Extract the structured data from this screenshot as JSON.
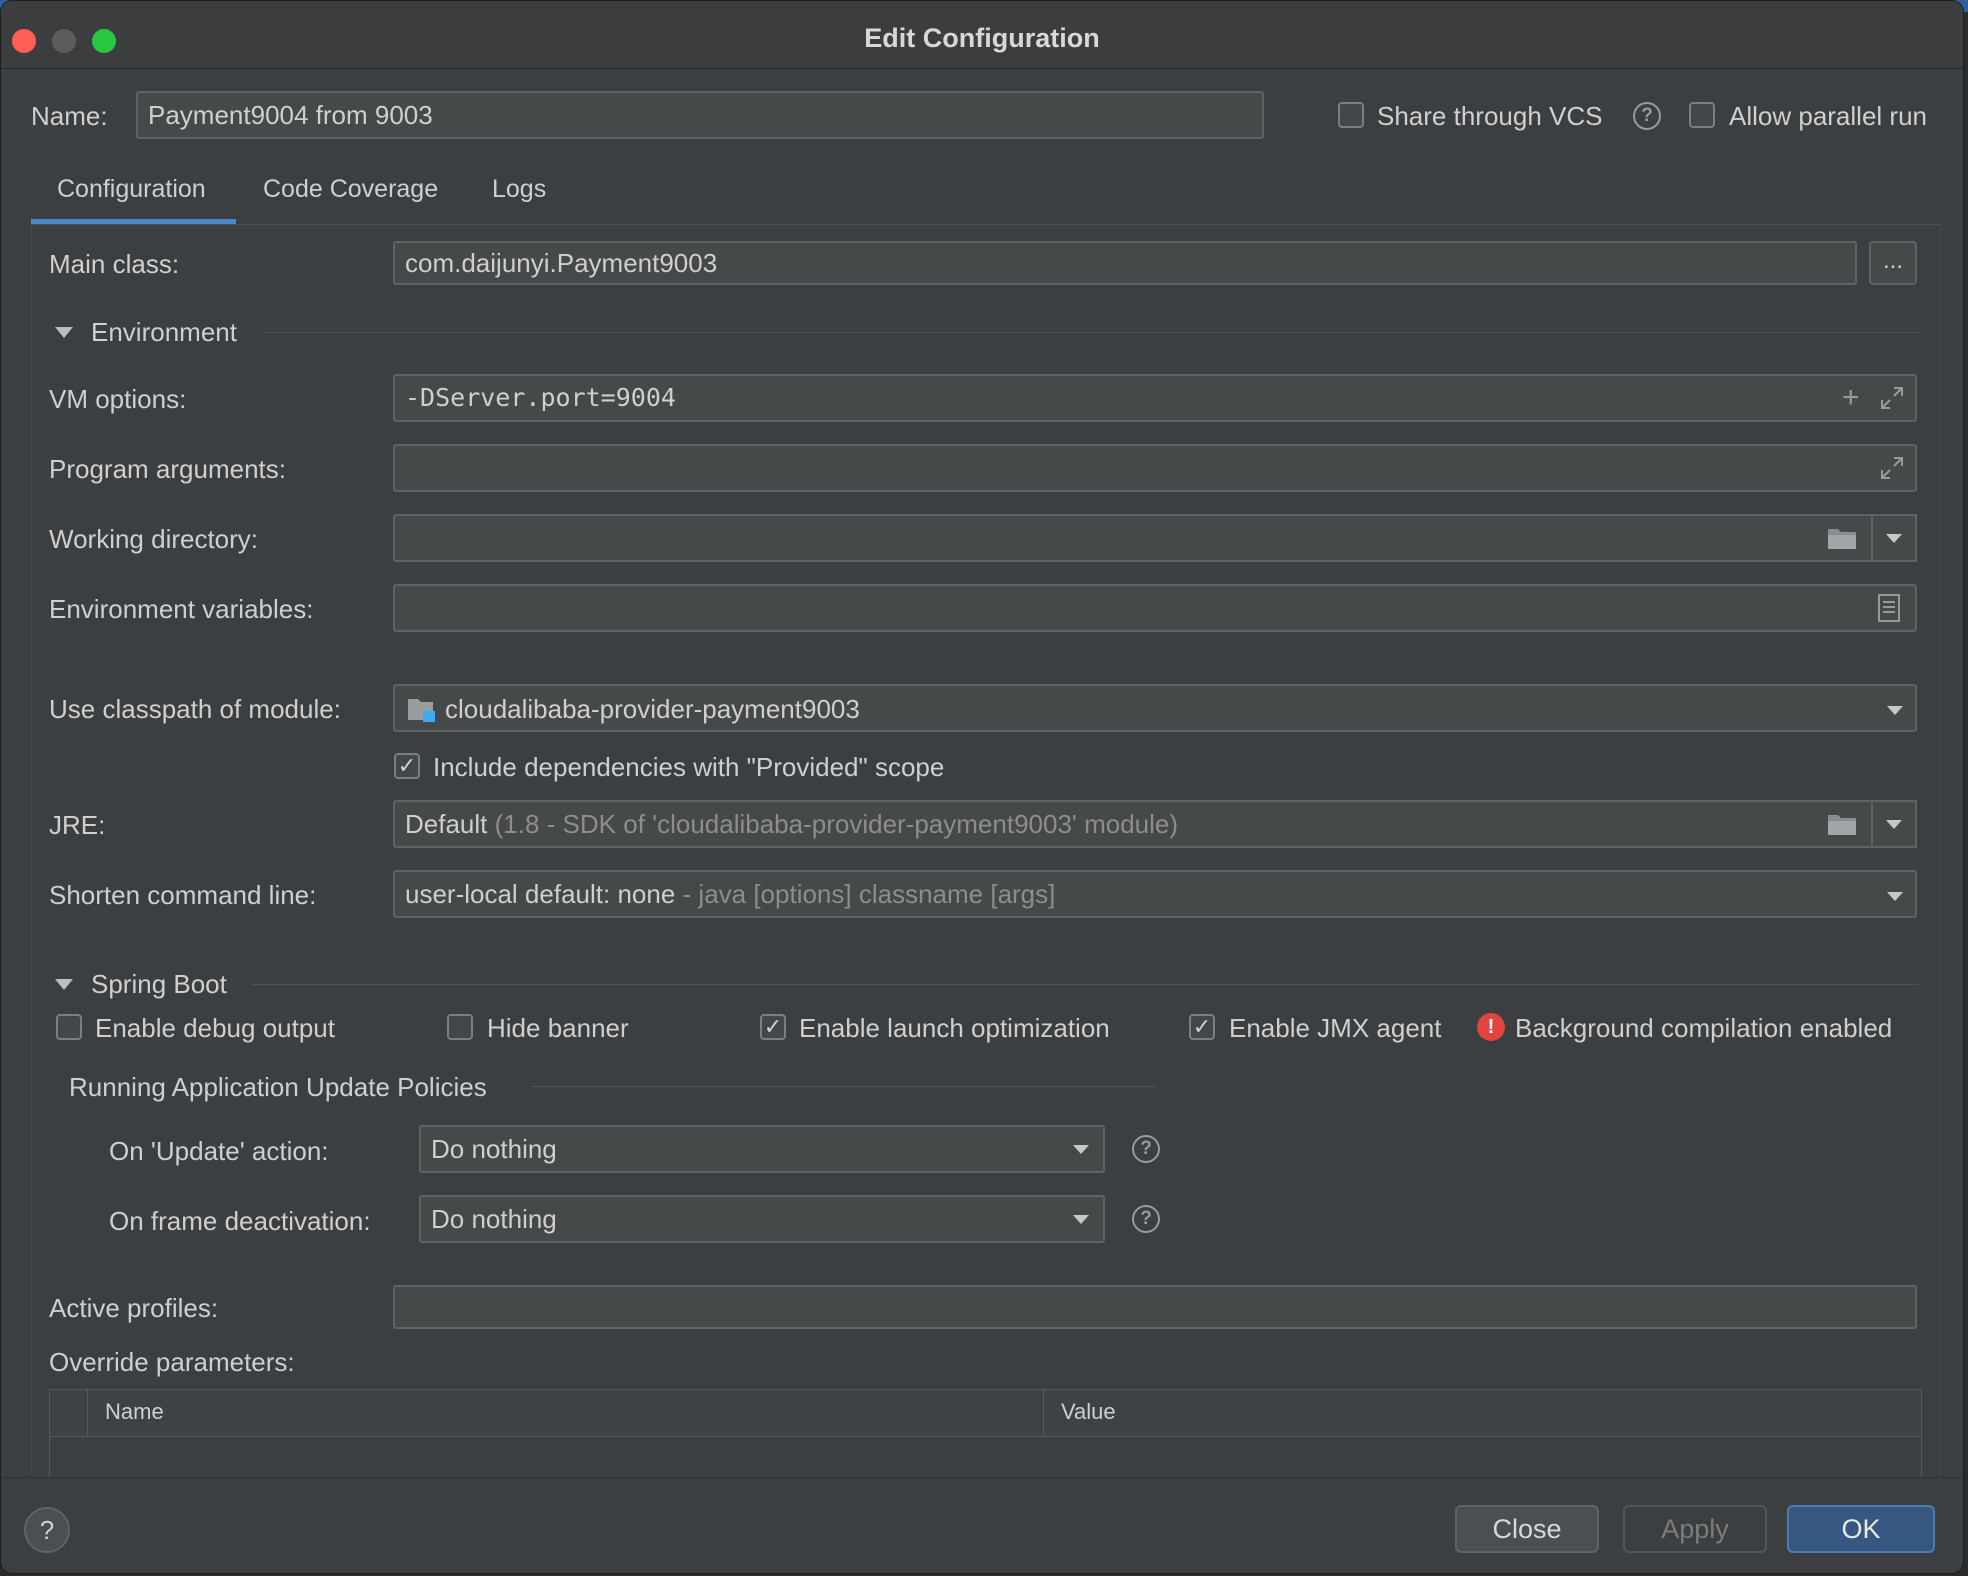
{
  "window": {
    "title": "Edit Configuration"
  },
  "header": {
    "name_label": "Name:",
    "name_value": "Payment9004 from 9003",
    "share_vcs_label": "Share through VCS",
    "share_vcs_checked": false,
    "allow_parallel_label": "Allow parallel run",
    "allow_parallel_checked": false
  },
  "tabs": [
    {
      "label": "Configuration",
      "active": true
    },
    {
      "label": "Code Coverage",
      "active": false
    },
    {
      "label": "Logs",
      "active": false
    }
  ],
  "config": {
    "main_class_label": "Main class:",
    "main_class_value": "com.daijunyi.Payment9003",
    "browse_label": "...",
    "environment_section": "Environment",
    "vm_options_label": "VM options:",
    "vm_options_value": "-DServer.port=9004",
    "program_args_label": "Program arguments:",
    "program_args_value": "",
    "working_dir_label": "Working directory:",
    "working_dir_value": "",
    "env_vars_label": "Environment variables:",
    "env_vars_value": "",
    "classpath_label": "Use classpath of module:",
    "classpath_value": "cloudalibaba-provider-payment9003",
    "include_deps_label": "Include dependencies with \"Provided\" scope",
    "include_deps_checked": true,
    "jre_label": "JRE:",
    "jre_value": "Default",
    "jre_hint": "(1.8 - SDK of 'cloudalibaba-provider-payment9003' module)",
    "shorten_label": "Shorten command line:",
    "shorten_value": "user-local default: none",
    "shorten_hint": "- java [options] classname [args]"
  },
  "spring_boot": {
    "section": "Spring Boot",
    "enable_debug_label": "Enable debug output",
    "enable_debug_checked": false,
    "hide_banner_label": "Hide banner",
    "hide_banner_checked": false,
    "launch_opt_label": "Enable launch optimization",
    "launch_opt_checked": true,
    "jmx_label": "Enable JMX agent",
    "jmx_checked": true,
    "bg_compile_label": "Background compilation enabled",
    "policies_section": "Running Application Update Policies",
    "on_update_label": "On 'Update' action:",
    "on_update_value": "Do nothing",
    "on_frame_label": "On frame deactivation:",
    "on_frame_value": "Do nothing",
    "active_profiles_label": "Active profiles:",
    "active_profiles_value": "",
    "override_label": "Override parameters:",
    "table_columns": [
      "Name",
      "Value"
    ]
  },
  "footer": {
    "help_label": "?",
    "close_label": "Close",
    "apply_label": "Apply",
    "ok_label": "OK"
  },
  "colors": {
    "accent": "#4a88c7",
    "error": "#e0443e",
    "primary_button": "#365880",
    "background": "#3c3f41"
  }
}
